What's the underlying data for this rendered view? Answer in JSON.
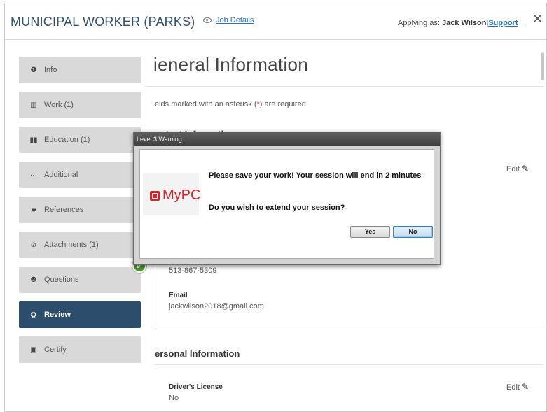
{
  "header": {
    "job_title": "MUNICIPAL WORKER (PARKS)",
    "job_details_link": "Job Details",
    "applying_as_label": "Applying as:",
    "applicant_name": "Jack Wilson",
    "separator": "|",
    "support_link": "Support",
    "close_symbol": "✕"
  },
  "sidebar": {
    "items": [
      {
        "label": "Info",
        "icon": "info-icon",
        "glyph": "❶"
      },
      {
        "label": "Work (1)",
        "icon": "briefcase-icon",
        "glyph": "▥"
      },
      {
        "label": "Education (1)",
        "icon": "book-icon",
        "glyph": "▮▮"
      },
      {
        "label": "Additional",
        "icon": "ellipsis-icon",
        "glyph": "···"
      },
      {
        "label": "References",
        "icon": "comment-icon",
        "glyph": "▰"
      },
      {
        "label": "Attachments (1)",
        "icon": "paperclip-icon",
        "glyph": "⊘"
      },
      {
        "label": "Questions",
        "icon": "question-icon",
        "glyph": "❷"
      },
      {
        "label": "Review",
        "icon": "review-icon",
        "glyph": "⛭"
      },
      {
        "label": "Certify",
        "icon": "certify-icon",
        "glyph": "▣"
      }
    ],
    "active_item": "Review",
    "active_color": "#2c4d6b",
    "check_symbol": "✔"
  },
  "main": {
    "section_title": "ieneral Information",
    "required_note_before": "elds marked with an asterisk (",
    "required_note_asterisk": "*",
    "required_note_after": ") are required",
    "contact_heading": "ontact Information",
    "edit_label": "Edit",
    "pencil_symbol": "✎",
    "phone": "513-867-5309",
    "email_label": "Email",
    "email_value": "jackwilson2018@gmail.com",
    "personal_heading": "ersonal Information",
    "drivers_license_label": "Driver's License",
    "drivers_license_value": "No"
  },
  "modal": {
    "title": "Level 3 Warning",
    "logo_text": "MyPC",
    "logo_color": "#d4242b",
    "message_line1": "Please save your work! Your session will end in 2 minutes",
    "message_line2": "Do you wish to extend your session?",
    "yes_label": "Yes",
    "no_label": "No"
  }
}
